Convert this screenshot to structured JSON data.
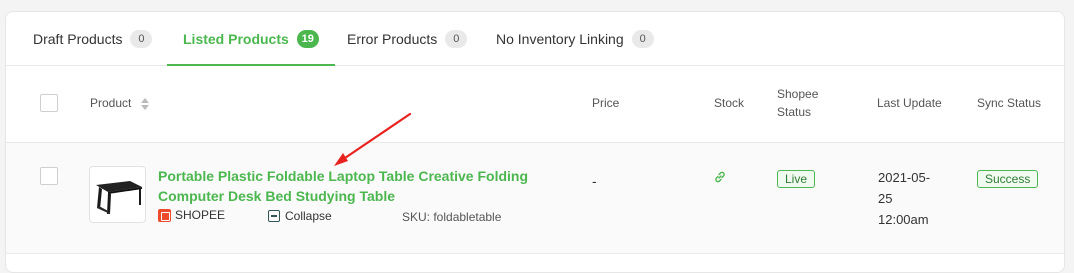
{
  "tabs": [
    {
      "label": "Draft Products",
      "count": "0"
    },
    {
      "label": "Listed Products",
      "count": "19"
    },
    {
      "label": "Error Products",
      "count": "0"
    },
    {
      "label": "No Inventory Linking",
      "count": "0"
    }
  ],
  "active_tab": "Listed Products",
  "table": {
    "headers": {
      "product": "Product",
      "price": "Price",
      "stock": "Stock",
      "shopee_status_line1": "Shopee",
      "shopee_status_line2": "Status",
      "last_update": "Last Update",
      "sync_status": "Sync Status"
    },
    "rows": [
      {
        "title": "Portable Plastic Foldable Laptop Table Creative Folding Computer Desk Bed Studying Table",
        "shop": "SHOPEE",
        "collapse_label": "Collapse",
        "sku": "SKU: foldabletable",
        "price": "-",
        "stock_icon": "link-icon",
        "shopee_status": "Live",
        "last_update_line1": "2021-05-",
        "last_update_line2": "25",
        "last_update_line3": "12:00am",
        "sync_status": "Success"
      }
    ]
  },
  "colors": {
    "accent": "#4cb74f",
    "shopee": "#ee4d2d",
    "annotation_arrow": "#e8231f"
  }
}
